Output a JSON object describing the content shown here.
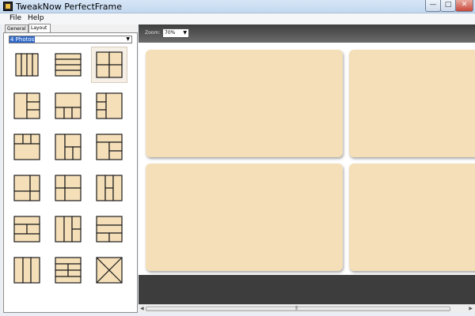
{
  "window": {
    "title": "TweakNow PerfectFrame"
  },
  "menu": {
    "file": "File",
    "help": "Help"
  },
  "tabs": {
    "general": "General",
    "layout": "Layout"
  },
  "layout_select": {
    "value": "4 Photos"
  },
  "toolbar": {
    "zoom_label": "Zoom:",
    "zoom_value": "70%"
  },
  "colors": {
    "frame_fill": "#f4dfb8",
    "toolbar_dark": "#3e3e3e",
    "strip_dark": "#3d3d3d",
    "selection_bg": "#f6efe6"
  },
  "icons": {
    "app": "app-icon",
    "dropdown": "chevron-down-icon",
    "scroll_left": "arrow-left-icon",
    "scroll_right": "arrow-right-icon"
  }
}
